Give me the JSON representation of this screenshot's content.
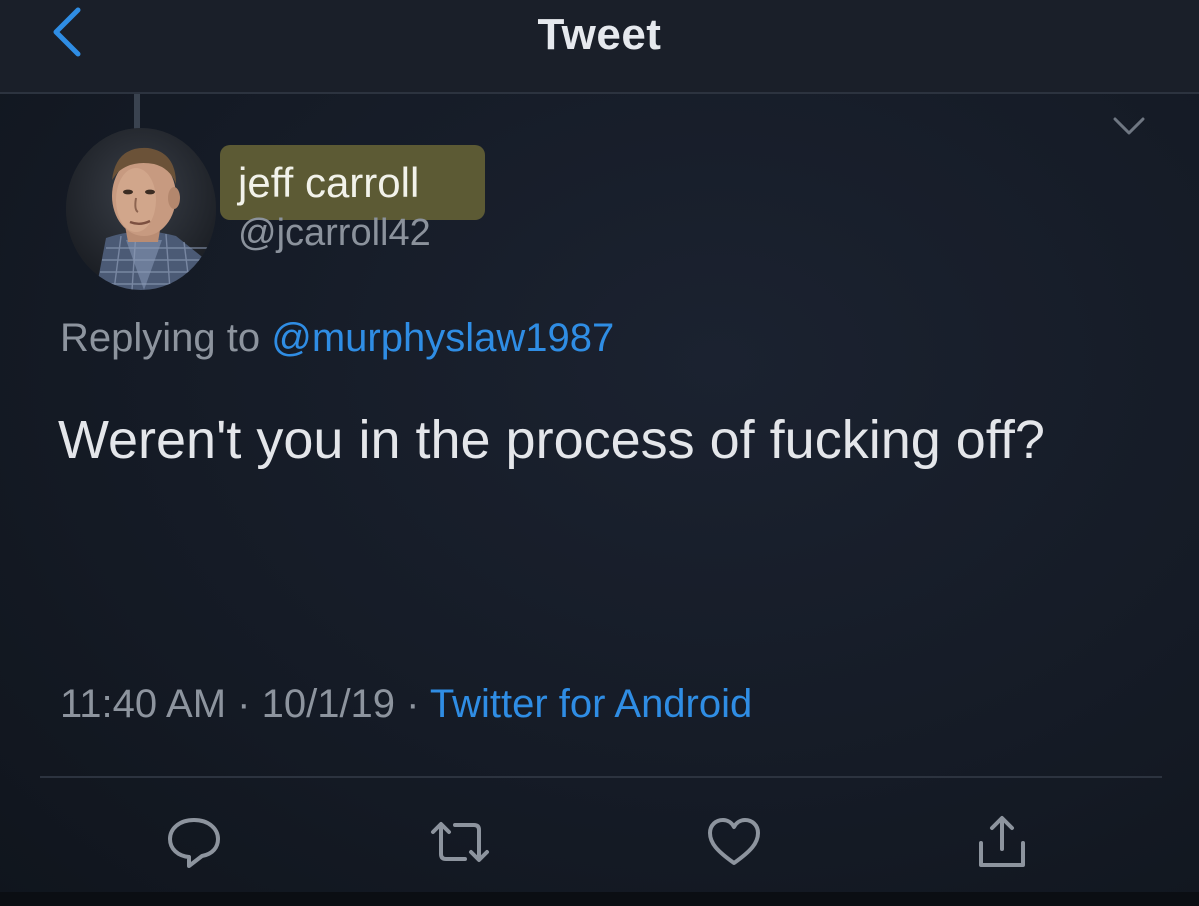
{
  "header": {
    "title": "Tweet",
    "back_icon": "chevron-left-icon"
  },
  "author": {
    "display_name": "jeff carroll",
    "handle": "@jcarroll42",
    "avatar_icon": "avatar-photo"
  },
  "reply": {
    "prefix": "Replying to",
    "mention": "@murphyslaw1987"
  },
  "tweet": {
    "text": "Weren't you in the process of fucking off?"
  },
  "meta": {
    "time": "11:40 AM",
    "separator1": " · ",
    "date": "10/1/19",
    "separator2": " · ",
    "source": "Twitter for Android"
  },
  "actions": [
    {
      "icon": "reply-icon"
    },
    {
      "icon": "retweet-icon"
    },
    {
      "icon": "like-icon"
    },
    {
      "icon": "share-icon"
    }
  ],
  "colors": {
    "accent": "#2f8de4",
    "background": "#151b26",
    "name_highlight": "#5c5a34"
  }
}
